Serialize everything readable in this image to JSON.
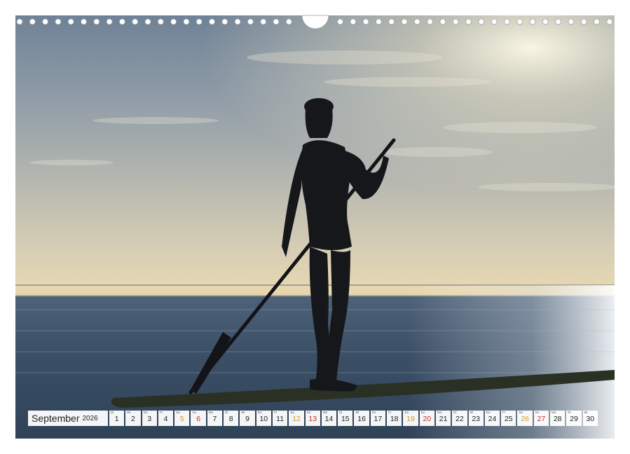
{
  "calendar": {
    "month": "September",
    "year": "2026",
    "days": [
      {
        "n": "1",
        "wd": "Di",
        "type": "weekday"
      },
      {
        "n": "2",
        "wd": "Mi",
        "type": "weekday"
      },
      {
        "n": "3",
        "wd": "Do",
        "type": "weekday"
      },
      {
        "n": "4",
        "wd": "Fr",
        "type": "weekday"
      },
      {
        "n": "5",
        "wd": "Sa",
        "type": "sat"
      },
      {
        "n": "6",
        "wd": "So",
        "type": "sun"
      },
      {
        "n": "7",
        "wd": "Mo",
        "type": "weekday"
      },
      {
        "n": "8",
        "wd": "Di",
        "type": "weekday"
      },
      {
        "n": "9",
        "wd": "Mi",
        "type": "weekday"
      },
      {
        "n": "10",
        "wd": "Do",
        "type": "weekday"
      },
      {
        "n": "11",
        "wd": "Fr",
        "type": "weekday"
      },
      {
        "n": "12",
        "wd": "Sa",
        "type": "sat"
      },
      {
        "n": "13",
        "wd": "So",
        "type": "sun"
      },
      {
        "n": "14",
        "wd": "Mo",
        "type": "weekday"
      },
      {
        "n": "15",
        "wd": "Di",
        "type": "weekday"
      },
      {
        "n": "16",
        "wd": "Mi",
        "type": "weekday"
      },
      {
        "n": "17",
        "wd": "Do",
        "type": "weekday"
      },
      {
        "n": "18",
        "wd": "Fr",
        "type": "weekday"
      },
      {
        "n": "19",
        "wd": "Sa",
        "type": "sat"
      },
      {
        "n": "20",
        "wd": "So",
        "type": "sun"
      },
      {
        "n": "21",
        "wd": "Mo",
        "type": "weekday"
      },
      {
        "n": "22",
        "wd": "Di",
        "type": "weekday"
      },
      {
        "n": "23",
        "wd": "Mi",
        "type": "weekday"
      },
      {
        "n": "24",
        "wd": "Do",
        "type": "weekday"
      },
      {
        "n": "25",
        "wd": "Fr",
        "type": "weekday"
      },
      {
        "n": "26",
        "wd": "Sa",
        "type": "sat"
      },
      {
        "n": "27",
        "wd": "So",
        "type": "sun"
      },
      {
        "n": "28",
        "wd": "Mo",
        "type": "weekday"
      },
      {
        "n": "29",
        "wd": "Di",
        "type": "weekday"
      },
      {
        "n": "30",
        "wd": "Mi",
        "type": "weekday"
      }
    ]
  },
  "colors": {
    "saturday": "#d99a1a",
    "sunday": "#c0302a",
    "weekday": "#222222"
  }
}
